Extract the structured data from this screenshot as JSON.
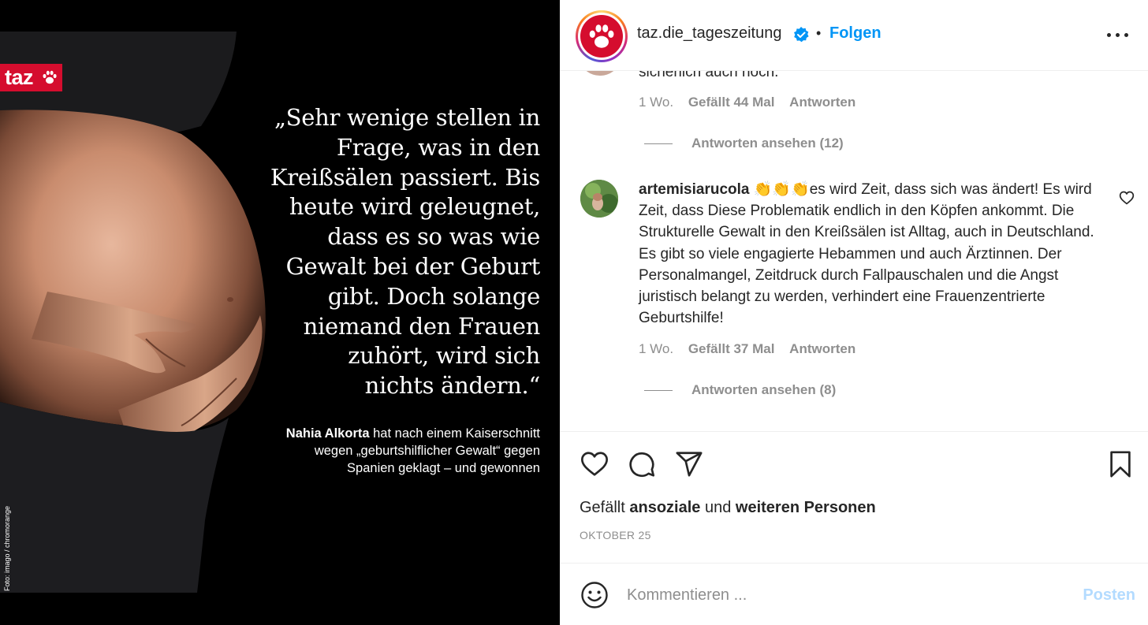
{
  "media": {
    "logo_text": "taz",
    "quote_lines": [
      "„Sehr wenige stellen in",
      "Frage, was in den",
      "Kreißsälen passiert. Bis",
      "heute wird geleugnet,",
      "dass es so was wie",
      "Gewalt bei der Geburt",
      "gibt. Doch solange",
      "niemand den Frauen",
      "zuhört, wird sich",
      "nichts ändern.“"
    ],
    "caption_name": "Nahia Alkorta",
    "caption_line1_rest": " hat nach einem Kaiserschnitt",
    "caption_line2": "wegen „geburtshilflicher Gewalt“ gegen",
    "caption_line3": "Spanien geklagt – und gewonnen",
    "photo_credit": "Foto: imago / chromorange"
  },
  "header": {
    "username": "taz.die_tageszeitung",
    "separator": "•",
    "follow_label": "Folgen",
    "more_icon": "more-horizontal-icon"
  },
  "comments": {
    "prev_text_cut": "sicherlich auch noch.",
    "prev_meta": {
      "time": "1 Wo.",
      "likes": "Gefällt 44 Mal",
      "reply": "Antworten"
    },
    "prev_view_replies": "Antworten ansehen (12)",
    "main": {
      "user": "artemisiarucola",
      "emojis": "👏👏👏",
      "text": "es wird Zeit, dass sich was ändert! Es wird Zeit, dass Diese Problematik endlich in den Köpfen ankommt. Die Strukturelle Gewalt in den Kreißsälen ist Alltag, auch in Deutschland. Es gibt so viele engagierte Hebammen und auch Ärztinnen. Der Personalmangel, Zeitdruck durch Fallpauschalen und die Angst juristisch belangt zu werden, verhindert eine Frauenzentrierte Geburtshilfe!",
      "time": "1 Wo.",
      "likes": "Gefällt 37 Mal",
      "reply": "Antworten",
      "view_replies": "Antworten ansehen (8)"
    }
  },
  "actions": {
    "likes_prefix": "Gefällt ",
    "likes_user": "ansoziale",
    "likes_middle": " und ",
    "likes_rest": "weiteren Personen",
    "date": "OKTOBER 25"
  },
  "comment_box": {
    "placeholder": "Kommentieren ...",
    "post_label": "Posten"
  },
  "colors": {
    "taz_red": "#d50d2e",
    "link_blue": "#0095f6",
    "post_disabled": "#b3dbff",
    "meta_gray": "#8e8e8e"
  }
}
